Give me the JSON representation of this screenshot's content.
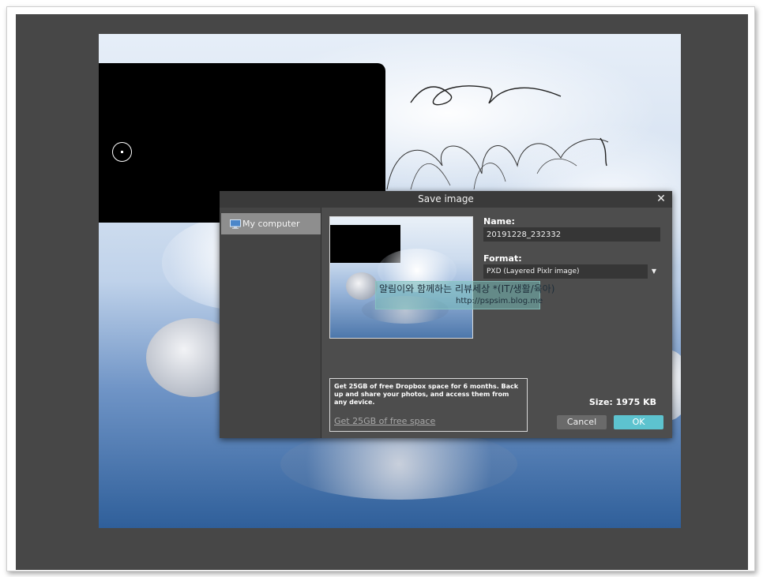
{
  "dialog": {
    "title": "Save image",
    "close_icon": "close-icon",
    "sidebar": {
      "items": [
        {
          "label": "My computer",
          "icon": "monitor-icon",
          "selected": true
        }
      ]
    },
    "name": {
      "label": "Name:",
      "value": "20191228_232332"
    },
    "format": {
      "label": "Format:",
      "selected": "PXD (Layered Pixlr image)",
      "icon": "chevron-down-icon"
    },
    "preview": {
      "watermark_line1": "알림이와 함께하는 리뷰세상 *(IT/생활/육아)",
      "watermark_line2": "http://pspsim.blog.me"
    },
    "promo": {
      "text": "Get 25GB of free Dropbox space for 6 months. Back up and share your photos, and access them from any device.",
      "link": "Get 25GB of free space"
    },
    "size": "Size: 1975 KB",
    "buttons": {
      "cancel": "Cancel",
      "ok": "OK"
    }
  },
  "colors": {
    "workspace": "#474747",
    "dialog_bg": "#4d4d4d",
    "title_bar": "#3a3a3a",
    "accent_ok": "#5dc3cf",
    "cancel": "#6a6a6a"
  }
}
